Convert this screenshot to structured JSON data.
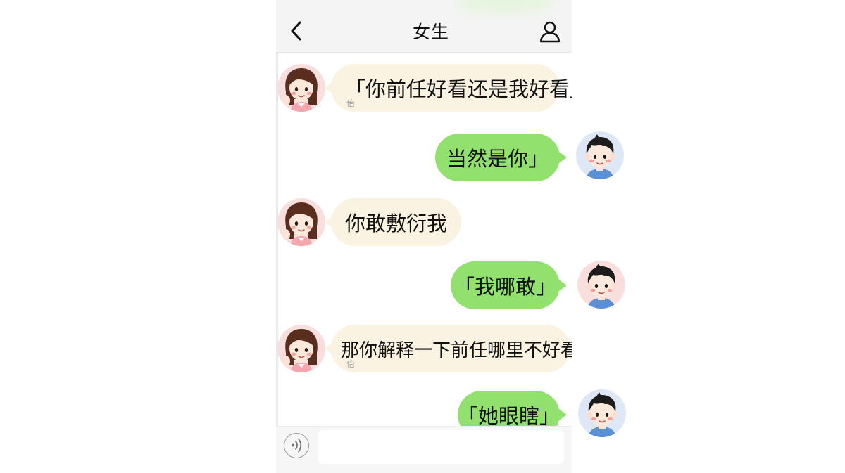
{
  "header": {
    "title": "女生",
    "back_icon": "chevron-left-icon",
    "profile_icon": "person-icon"
  },
  "messages": [
    {
      "side": "left",
      "speaker": "girl",
      "text": "「你前任好看还是我好看」",
      "sub": "佁"
    },
    {
      "side": "right",
      "speaker": "boy",
      "text": "当然是你」"
    },
    {
      "side": "left",
      "speaker": "girl",
      "text": "你敢敷衍我"
    },
    {
      "side": "right",
      "speaker": "boy",
      "text": "「我哪敢」"
    },
    {
      "side": "left",
      "speaker": "girl",
      "text": "那你解释一下前任哪里不好看",
      "sub": "佁"
    },
    {
      "side": "right",
      "speaker": "boy",
      "text": "「她眼瞎」"
    }
  ],
  "input_bar": {
    "voice_icon": "voice-icon",
    "placeholder": ""
  },
  "colors": {
    "sent_bubble": "#92e06d",
    "received_bubble": "#fbf3e1",
    "nav_background": "#f4f4f4"
  }
}
